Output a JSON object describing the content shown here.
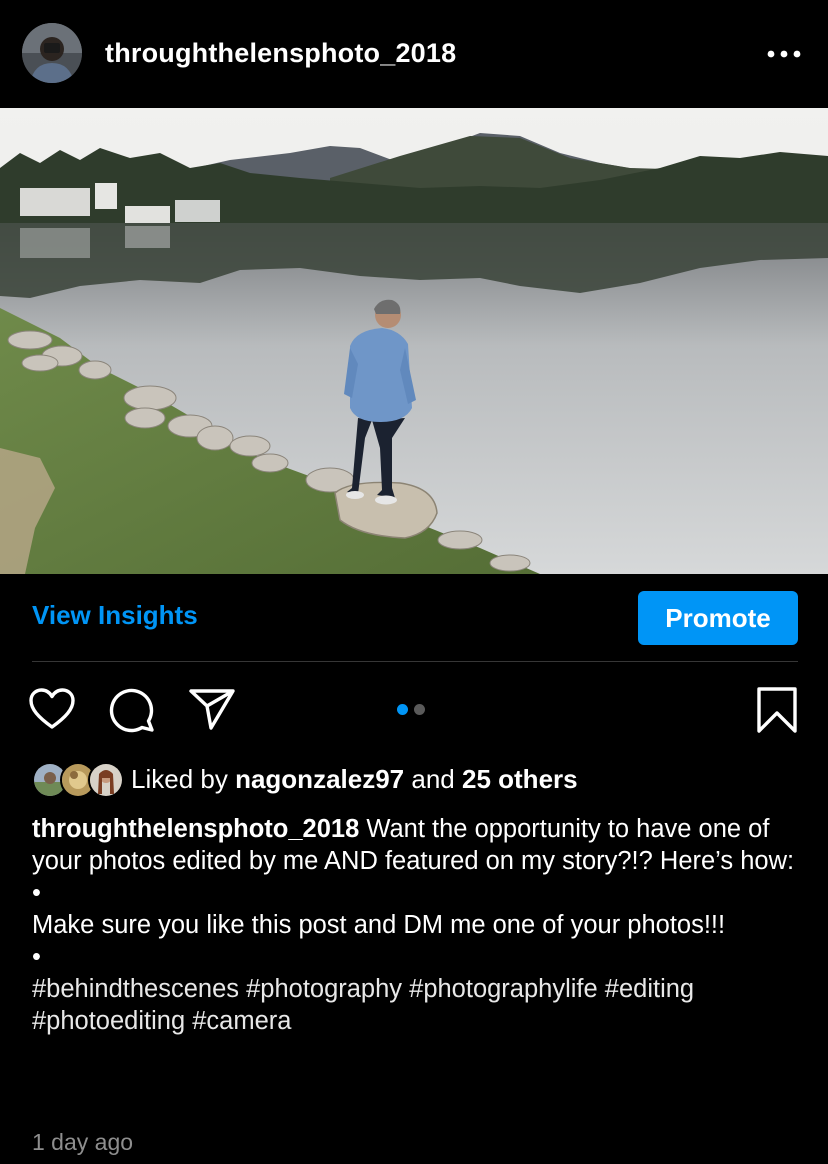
{
  "post": {
    "username": "throughthelensphoto_2018",
    "more_icon": "ellipsis-icon"
  },
  "actions": {
    "view_insights": "View Insights",
    "promote": "Promote",
    "like_icon": "heart-icon",
    "comment_icon": "comment-bubble-icon",
    "share_icon": "paper-plane-icon",
    "save_icon": "bookmark-icon",
    "carousel": {
      "total": 2,
      "current": 1
    }
  },
  "likes": {
    "prefix": "Liked by",
    "user": "nagonzalez97",
    "connector": "and",
    "others": "25 others"
  },
  "caption": {
    "user": "throughthelensphoto_2018",
    "line1": "Want the opportunity to have one of your photos edited by me AND featured on my story?!? Here’s how:",
    "bullet1": "•",
    "line2": "Make sure you like this post and DM me one of your photos!!!",
    "bullet2": "•",
    "hashtags": "#behindthescenes #photography #photographylife #editing #photoediting #camera"
  },
  "timestamp": "1 day ago",
  "colors": {
    "accent": "#0095f6",
    "background": "#000000",
    "secondary_text": "#8e8e8e"
  }
}
